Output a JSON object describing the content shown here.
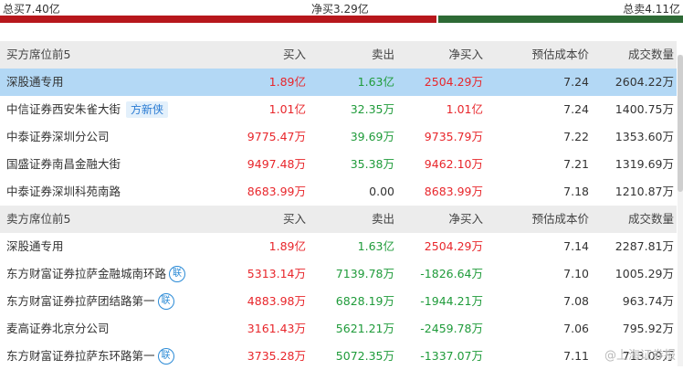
{
  "summary": {
    "total_buy": "总买7.40亿",
    "net_buy": "净买3.29亿",
    "total_sell": "总卖4.11亿",
    "buy_ratio": 0.64
  },
  "buy_section": {
    "headers": [
      "买方席位前5",
      "买入",
      "卖出",
      "净买入",
      "预估成本价",
      "成交数量"
    ],
    "rows": [
      {
        "name": "深股通专用",
        "tag": "",
        "lian": false,
        "buy": "1.89亿",
        "sell": "1.63亿",
        "net": "2504.29万",
        "cost": "7.24",
        "vol": "2604.22万"
      },
      {
        "name": "中信证券西安朱雀大街",
        "tag": "方新侠",
        "lian": false,
        "buy": "1.01亿",
        "sell": "32.35万",
        "net": "1.01亿",
        "cost": "7.24",
        "vol": "1400.75万"
      },
      {
        "name": "中泰证券深圳分公司",
        "tag": "",
        "lian": false,
        "buy": "9775.47万",
        "sell": "39.69万",
        "net": "9735.79万",
        "cost": "7.22",
        "vol": "1353.60万"
      },
      {
        "name": "国盛证券南昌金融大街",
        "tag": "",
        "lian": false,
        "buy": "9497.48万",
        "sell": "35.38万",
        "net": "9462.10万",
        "cost": "7.21",
        "vol": "1319.69万"
      },
      {
        "name": "中泰证券深圳科苑南路",
        "tag": "",
        "lian": false,
        "buy": "8683.99万",
        "sell": "0.00",
        "net": "8683.99万",
        "cost": "7.18",
        "vol": "1210.87万"
      }
    ]
  },
  "sell_section": {
    "headers": [
      "卖方席位前5",
      "买入",
      "卖出",
      "净买入",
      "预估成本价",
      "成交数量"
    ],
    "rows": [
      {
        "name": "深股通专用",
        "tag": "",
        "lian": false,
        "buy": "1.89亿",
        "sell": "1.63亿",
        "net": "2504.29万",
        "cost": "7.14",
        "vol": "2287.81万"
      },
      {
        "name": "东方财富证券拉萨金融城南环路",
        "tag": "",
        "lian": true,
        "buy": "5313.14万",
        "sell": "7139.78万",
        "net": "-1826.64万",
        "cost": "7.10",
        "vol": "1005.29万"
      },
      {
        "name": "东方财富证券拉萨团结路第一",
        "tag": "",
        "lian": true,
        "buy": "4883.98万",
        "sell": "6828.19万",
        "net": "-1944.21万",
        "cost": "7.08",
        "vol": "963.74万"
      },
      {
        "name": "麦高证券北京分公司",
        "tag": "",
        "lian": false,
        "buy": "3161.43万",
        "sell": "5621.21万",
        "net": "-2459.78万",
        "cost": "7.06",
        "vol": "795.92万"
      },
      {
        "name": "东方财富证券拉萨东环路第一",
        "tag": "",
        "lian": true,
        "buy": "3735.28万",
        "sell": "5072.35万",
        "net": "-1337.07万",
        "cost": "7.11",
        "vol": "713.09万"
      }
    ]
  },
  "lian_glyph": "联",
  "watermark": "@上海证券报"
}
